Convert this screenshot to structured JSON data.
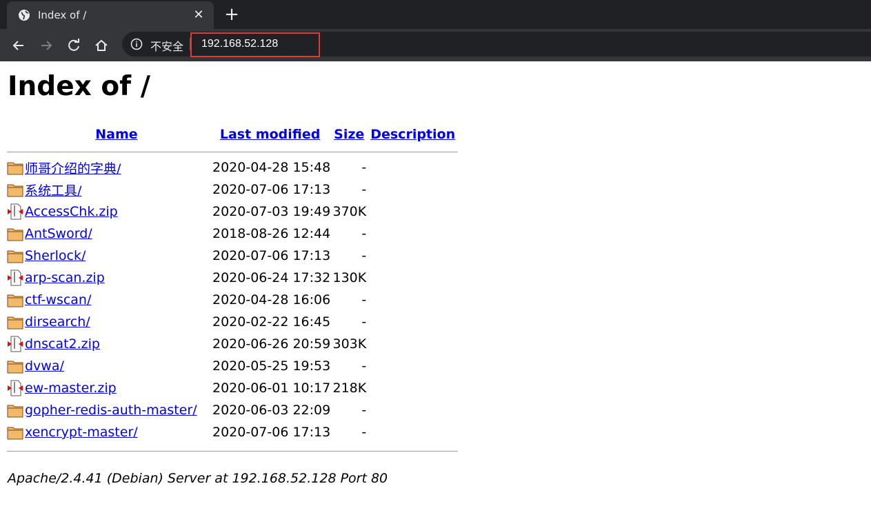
{
  "browser": {
    "tab_title": "Index of /",
    "security_label": "不安全",
    "url": "192.168.52.128"
  },
  "page": {
    "heading": "Index of /",
    "columns": {
      "name": "Name",
      "last_modified": "Last modified",
      "size": "Size",
      "description": "Description"
    },
    "entries": [
      {
        "icon": "folder-icon",
        "name": "师哥介绍的字典/",
        "modified": "2020-04-28 15:48",
        "size": "-"
      },
      {
        "icon": "folder-icon",
        "name": "系统工具/",
        "modified": "2020-07-06 17:13",
        "size": "-"
      },
      {
        "icon": "archive-icon",
        "name": "AccessChk.zip",
        "modified": "2020-07-03 19:49",
        "size": "370K"
      },
      {
        "icon": "folder-icon",
        "name": "AntSword/",
        "modified": "2018-08-26 12:44",
        "size": "-"
      },
      {
        "icon": "folder-icon",
        "name": "Sherlock/",
        "modified": "2020-07-06 17:13",
        "size": "-"
      },
      {
        "icon": "archive-icon",
        "name": "arp-scan.zip",
        "modified": "2020-06-24 17:32",
        "size": "130K"
      },
      {
        "icon": "folder-icon",
        "name": "ctf-wscan/",
        "modified": "2020-04-28 16:06",
        "size": "-"
      },
      {
        "icon": "folder-icon",
        "name": "dirsearch/",
        "modified": "2020-02-22 16:45",
        "size": "-"
      },
      {
        "icon": "archive-icon",
        "name": "dnscat2.zip",
        "modified": "2020-06-26 20:59",
        "size": "303K"
      },
      {
        "icon": "folder-icon",
        "name": "dvwa/",
        "modified": "2020-05-25 19:53",
        "size": "-"
      },
      {
        "icon": "archive-icon",
        "name": "ew-master.zip",
        "modified": "2020-06-01 10:17",
        "size": "218K"
      },
      {
        "icon": "folder-icon",
        "name": "gopher-redis-auth-master/",
        "modified": "2020-06-03 22:09",
        "size": "-"
      },
      {
        "icon": "folder-icon",
        "name": "xencrypt-master/",
        "modified": "2020-07-06 17:13",
        "size": "-"
      }
    ],
    "footer": "Apache/2.4.41 (Debian) Server at 192.168.52.128 Port 80"
  },
  "colors": {
    "link": "#0000ee",
    "chrome_bg": "#35363a",
    "tabstrip_bg": "#202124",
    "url_highlight": "#e53935"
  }
}
